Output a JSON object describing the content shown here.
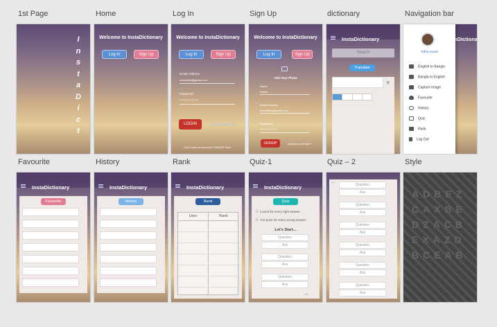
{
  "labels": {
    "first_page": "1st Page",
    "home": "Home",
    "login": "Log In",
    "signup": "Sign Up",
    "dictionary": "dictionary",
    "navbar": "Navigation bar",
    "favourite": "Favourite",
    "history": "History",
    "rank": "Rank",
    "quiz1": "Quiz-1",
    "quiz2": "Quiz – 2",
    "style": "Style"
  },
  "first_page": {
    "letters": [
      "I",
      "n",
      "s",
      "t",
      "a",
      "D",
      "i",
      "c",
      "t"
    ]
  },
  "home": {
    "welcome": "Welcome to InstaDictionary",
    "login": "Log In",
    "signup": "Sign Up"
  },
  "login": {
    "welcome": "Welcome to InstaDictionary",
    "login_tab": "Log In",
    "signup_tab": "Sign Up",
    "email_label": "Email Address",
    "email_value": "mrtsmtfaa@gmail.com",
    "password_label": "Password",
    "password_value": "••••••••••",
    "login_button": "LOGIN",
    "forgot": "Forgot Password",
    "footer": "Don't have an account? SIGNUP Here"
  },
  "signup": {
    "welcome": "Welcome to InstaDictionary",
    "login_tab": "Log In",
    "signup_tab": "Sign Up",
    "add_photo": "Add Your Photo",
    "name_label": "Name",
    "name_value": "Samia",
    "email_label": "Email Address",
    "email_value": "mrtsmtfaa@gmail.com",
    "password_label": "Password",
    "password_value": "••••••••••",
    "signup_button": "SIGNUP",
    "footer": "Already a member?"
  },
  "dictionary": {
    "app_title": "InstaDictionary",
    "search_placeholder": "Search",
    "translate": "Translate"
  },
  "navbar": {
    "app_title": "InstaDictionary",
    "user": "Tofha Aasob",
    "items": [
      "English to Bangla",
      "Bangla to English",
      "Capture Image",
      "Favourite",
      "History",
      "Quiz",
      "Rank",
      "Log Out"
    ]
  },
  "favourite": {
    "app_title": "InstaDictionary",
    "pill": "Favourite"
  },
  "history": {
    "app_title": "InstaDictionary",
    "pill": "History"
  },
  "rank": {
    "app_title": "InstaDictionary",
    "pill": "Rank",
    "col_user": "User",
    "col_rank": "Rank"
  },
  "quiz1": {
    "app_title": "InstaDictionary",
    "pill": "Quiz",
    "rule1": "1 point for every right answer",
    "rule2": "-0.5 point for every wrong answer",
    "start": "Let's Start...",
    "question": "Question",
    "ans": "Ans"
  },
  "quiz2": {
    "question": "Question",
    "ans": "Ans"
  },
  "colors": {
    "blue_btn": "#5b8fd6",
    "pink_btn": "#e27c94",
    "red_btn": "#c4322a",
    "teal_pill": "#1fb5b0",
    "rank_pill": "#2f5c9a"
  }
}
